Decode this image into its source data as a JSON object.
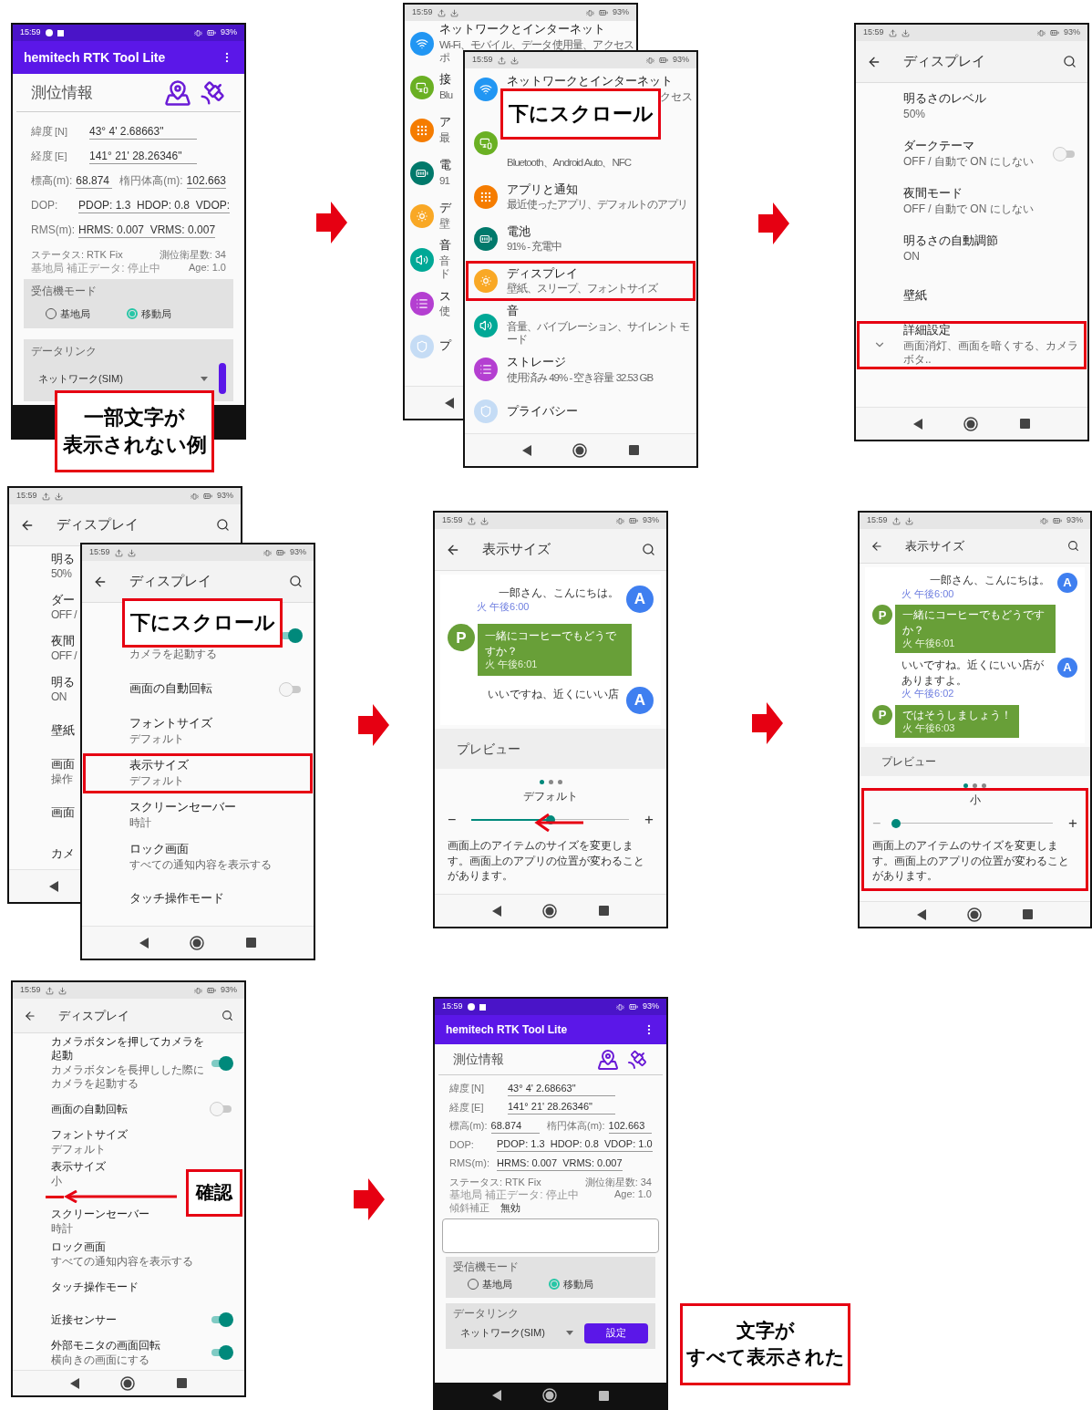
{
  "screens": [
    {
      "kind": "app",
      "status": {
        "time": "15:59",
        "battery": "93%"
      },
      "app_title": "hemitech RTK Tool Lite",
      "section": "測位情報",
      "coords": [
        {
          "label": "緯度",
          "unit": "[N]",
          "value": "43° 4' 2.68663\""
        },
        {
          "label": "経度",
          "unit": "[E]",
          "value": "141° 21' 28.26346\""
        }
      ],
      "height": {
        "label": "標高(m):",
        "value": "68.874"
      },
      "ellipsoid": {
        "label": "楕円体高(m):",
        "value": "102.663"
      },
      "dop": {
        "label": "DOP:",
        "value": "PDOP: 1.3  HDOP: 0.8  VDOP:"
      },
      "rms": {
        "label": "RMS(m):",
        "value": "HRMS: 0.007  VRMS: 0.007"
      },
      "fix_status": "ステータス: RTK Fix",
      "satellites": "測位衛星数: 34",
      "base_data": "基地局 補正データ: 停止中",
      "age": "Age: 1.0",
      "receiver_mode": {
        "title": "受信機モード",
        "options": [
          {
            "label": "基地局",
            "selected": false
          },
          {
            "label": "移動局",
            "selected": true
          }
        ]
      },
      "data_link": {
        "title": "データリンク",
        "value": "ネットワーク(SIM)",
        "button_clipped": true
      },
      "nav_buttons": false
    },
    {
      "kind": "settings_list",
      "status": {
        "time": "15:59",
        "battery": "93%"
      },
      "items": [
        {
          "title": "ネットワークとインターネット",
          "subtitle": "Wi-Fi、モバイル、データ使用量、アクセス",
          "subtitle2": "ポ",
          "color": "#2196f3",
          "highlighted": false
        },
        {
          "title": "接",
          "subtitle": "Blu",
          "color": "#6ab023",
          "highlighted": false
        },
        {
          "title": "ア",
          "subtitle": "最",
          "color": "#f57c00",
          "highlighted": false
        },
        {
          "title": "電",
          "subtitle": "91",
          "color": "#00796b",
          "highlighted": false
        },
        {
          "title": "デ",
          "subtitle": "壁",
          "color": "#f9a825",
          "highlighted": false
        },
        {
          "title": "音",
          "subtitle": "音",
          "subtitle2": "ド",
          "color": "#00a896",
          "highlighted": false
        },
        {
          "title": "ス",
          "subtitle": "使",
          "color": "#b43fd1",
          "highlighted": false
        },
        {
          "title": "プ",
          "color": "#c5dcf5",
          "highlighted": false
        }
      ]
    },
    {
      "kind": "settings_list",
      "status": {
        "time": "15:59",
        "battery": "93%"
      },
      "items": [
        {
          "title": "ネットワークとインターネット",
          "subtitle_tail": "クセス",
          "color": "#2196f3",
          "highlighted": false
        },
        {
          "subtitle": "Bluetooth、Android Auto、NFC",
          "color": "#6ab023",
          "highlighted": false
        },
        {
          "title": "アプリと通知",
          "subtitle": "最近使ったアプリ、デフォルトのアプリ",
          "color": "#f57c00",
          "highlighted": false
        },
        {
          "title": "電池",
          "subtitle": "91% - 充電中",
          "color": "#00796b",
          "highlighted": false
        },
        {
          "title": "ディスプレイ",
          "subtitle": "壁紙、スリープ、フォントサイズ",
          "color": "#f9a825",
          "highlighted": true
        },
        {
          "title": "音",
          "subtitle": "音量、バイブレーション、サイレント モード",
          "color": "#00a896",
          "highlighted": false
        },
        {
          "title": "ストレージ",
          "subtitle": "使用済み 49% - 空き容量 32.53 GB",
          "color": "#b43fd1",
          "highlighted": false
        },
        {
          "title": "プライバシー",
          "color": "#c5dcf5",
          "highlighted": false
        }
      ]
    },
    {
      "kind": "display_settings",
      "status": {
        "time": "15:59",
        "battery": "93%"
      },
      "title": "ディスプレイ",
      "items": [
        {
          "title": "明るさのレベル",
          "subtitle": "50%",
          "highlighted": false
        },
        {
          "title": "ダークテーマ",
          "subtitle": "OFF / 自動で ON にしない",
          "on": false,
          "highlighted": false
        },
        {
          "title": "夜間モード",
          "subtitle": "OFF / 自動で ON にしない",
          "highlighted": false
        },
        {
          "title": "明るさの自動調節",
          "subtitle": "ON",
          "highlighted": false
        },
        {
          "title": "壁紙",
          "highlighted": false
        },
        {
          "title": "詳細設定",
          "subtitle": "画面消灯、画面を暗くする、カメラボタ..",
          "expandable": true,
          "highlighted": true
        }
      ]
    },
    {
      "kind": "display_settings",
      "status": {
        "time": "15:59",
        "battery": "93%"
      },
      "title": "ディスプレイ",
      "items": [
        {
          "title": "明る",
          "subtitle": "50%"
        },
        {
          "title": "ダー",
          "subtitle": "OFF /"
        },
        {
          "title": "夜間",
          "subtitle": "OFF /"
        },
        {
          "title": "明る",
          "subtitle": "ON"
        },
        {
          "title": "壁紙"
        },
        {
          "title": "画面",
          "subtitle": "操作"
        },
        {
          "title": "画面"
        },
        {
          "title": "カメ"
        }
      ]
    },
    {
      "kind": "display_settings",
      "status": {
        "time": "15:59",
        "battery": "93%"
      },
      "title": "ディスプレイ",
      "items": [
        {
          "subtitle": "カメラを起動する",
          "on": true,
          "highlighted": false
        },
        {
          "title": "画面の自動回転",
          "on": false,
          "highlighted": false
        },
        {
          "title": "フォントサイズ",
          "subtitle": "デフォルト",
          "highlighted": false
        },
        {
          "title": "表示サイズ",
          "subtitle": "デフォルト",
          "highlighted": true
        },
        {
          "title": "スクリーンセーバー",
          "subtitle": "時計",
          "highlighted": false
        },
        {
          "title": "ロック画面",
          "subtitle": "すべての通知内容を表示する",
          "highlighted": false
        },
        {
          "title": "タッチ操作モード",
          "highlighted": false
        }
      ]
    },
    {
      "kind": "display_size",
      "status": {
        "time": "15:59",
        "battery": "93%"
      },
      "title": "表示サイズ",
      "messages": [
        {
          "kind": "plain",
          "text": "一郎さん、こんにちは。",
          "time": "火 午後6:00",
          "avatar": "A"
        },
        {
          "kind": "bubble",
          "text": "一緒にコーヒーでもどうですか？",
          "time": "火 午後6:01",
          "avatar": "P"
        },
        {
          "kind": "plain",
          "text": "いいですね、近くにいい店",
          "avatar": "A"
        }
      ],
      "preview": "プレビュー",
      "dots": [
        {
          "selected": true
        },
        {
          "selected": false
        },
        {
          "selected": false
        }
      ],
      "size_label": "デフォルト",
      "minus": "−",
      "plus": "+",
      "level": 0.5,
      "description": "画面上のアイテムのサイズを変更します。画面上のアプリの位置が変わることがあります。",
      "highlighted": false
    },
    {
      "kind": "display_size",
      "status": {
        "time": "15:59",
        "battery": "93%"
      },
      "title": "表示サイズ",
      "messages": [
        {
          "kind": "plain",
          "text": "一郎さん、こんにちは。",
          "time": "火 午後6:00",
          "avatar": "A"
        },
        {
          "kind": "bubble",
          "text": "一緒にコーヒーでもどうですか？",
          "time": "火 午後6:01",
          "avatar": "P"
        },
        {
          "kind": "plain",
          "text": "いいですね。近くにいい店がありますよ。",
          "time": "火 午後6:02",
          "avatar": "A"
        },
        {
          "kind": "bubble",
          "text": "ではそうしましょう！",
          "time": "火 午後6:03",
          "avatar": "P"
        }
      ],
      "preview": "プレビュー",
      "dots": [
        {
          "selected": true
        },
        {
          "selected": false
        },
        {
          "selected": false
        }
      ],
      "size_label": "小",
      "minus": "−",
      "plus": "+",
      "level": 0,
      "description": "画面上のアイテムのサイズを変更します。画面上のアプリの位置が変わることがあります。",
      "highlighted": true
    },
    {
      "kind": "display_settings",
      "status": {
        "time": "15:59",
        "battery": "93%"
      },
      "title": "ディスプレイ",
      "items": [
        {
          "title": "カメラボタンを押してカメラを起動",
          "subtitle": "カメラボタンを長押しした際にカメラを起動する",
          "on": true,
          "marked": false
        },
        {
          "title": "画面の自動回転",
          "on": false,
          "marked": false
        },
        {
          "title": "フォントサイズ",
          "subtitle": "デフォルト",
          "marked": false
        },
        {
          "title": "表示サイズ",
          "subtitle": "小",
          "marked": true
        },
        {
          "title": "スクリーンセーバー",
          "subtitle": "時計",
          "marked": false
        },
        {
          "title": "ロック画面",
          "subtitle": "すべての通知内容を表示する",
          "marked": false
        },
        {
          "title": "タッチ操作モード",
          "marked": false
        },
        {
          "title": "近接センサー",
          "on": true,
          "marked": false
        },
        {
          "title": "外部モニタの画面回転",
          "subtitle": "横向きの画面にする",
          "on": true,
          "marked": false
        }
      ]
    },
    {
      "kind": "app",
      "status": {
        "time": "15:59",
        "battery": "93%"
      },
      "app_title": "hemitech RTK Tool Lite",
      "section": "測位情報",
      "coords": [
        {
          "label": "緯度",
          "unit": "[N]",
          "value": "43° 4' 2.68663\""
        },
        {
          "label": "経度",
          "unit": "[E]",
          "value": "141° 21' 28.26346\""
        }
      ],
      "height": {
        "label": "標高(m):",
        "value": "68.874"
      },
      "ellipsoid": {
        "label": "楕円体高(m):",
        "value": "102.663"
      },
      "dop": {
        "label": "DOP:",
        "value": "PDOP: 1.3  HDOP: 0.8  VDOP: 1.0"
      },
      "rms": {
        "label": "RMS(m):",
        "value": "HRMS: 0.007  VRMS: 0.007"
      },
      "fix_status": "ステータス: RTK Fix",
      "satellites": "測位衛星数: 34",
      "base_data": "基地局 補正データ: 停止中",
      "age": "Age: 1.0",
      "tilt": {
        "label": "傾斜補正",
        "value": "無効"
      },
      "log_area": true,
      "receiver_mode": {
        "title": "受信機モード",
        "options": [
          {
            "label": "基地局",
            "selected": false
          },
          {
            "label": "移動局",
            "selected": true
          }
        ]
      },
      "data_link": {
        "title": "データリンク",
        "value": "ネットワーク(SIM)",
        "button": "設定"
      },
      "nav_buttons": true
    }
  ],
  "callouts": [
    {
      "lines": [
        "一部文字が",
        "表示されない例"
      ]
    },
    {
      "lines": [
        "下にスクロール"
      ]
    },
    {
      "lines": [
        "下にスクロール"
      ]
    },
    {
      "lines": [
        "確認"
      ]
    },
    {
      "lines": [
        "文字が",
        "すべて表示された"
      ]
    }
  ]
}
